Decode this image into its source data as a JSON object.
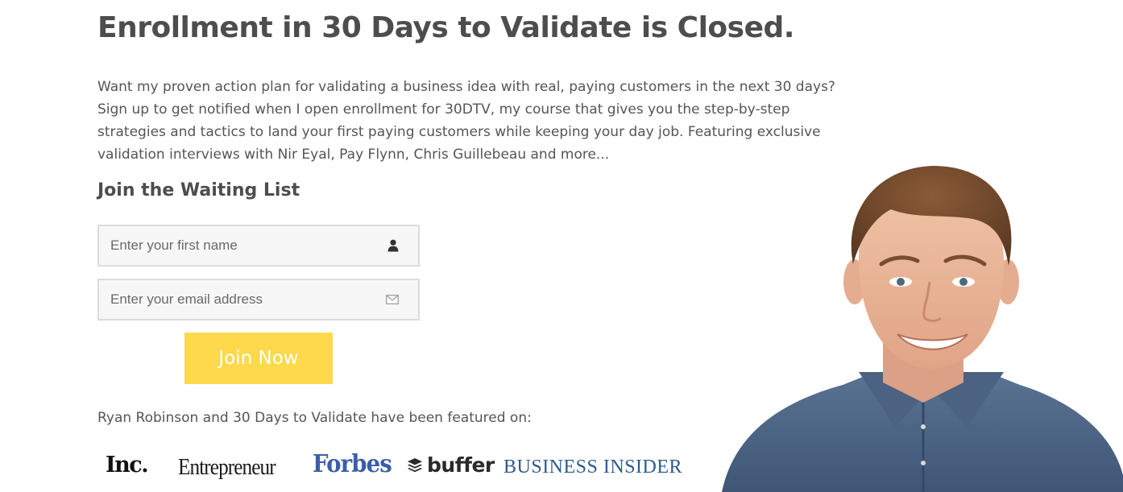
{
  "headline": "Enrollment in 30 Days to Validate is Closed.",
  "intro": "Want my proven action plan for validating a business idea with real, paying customers in the next 30 days? Sign up to get notified when I open enrollment for 30DTV, my course that gives you the step-by-step strategies and tactics to land your first paying customers while keeping your day job. Featuring exclusive validation interviews with Nir Eyal, Pay Flynn, Chris Guillebeau and more...",
  "waitlist": {
    "title": "Join the Waiting List",
    "first_name_placeholder": "Enter your first name",
    "first_name_icon": "person-icon",
    "email_placeholder": "Enter your email address",
    "email_icon": "envelope-icon",
    "submit_label": "Join Now",
    "submit_color": "#fdd94b"
  },
  "featured": {
    "label": "Ryan Robinson and 30 Days to Validate have been featured on:",
    "logos": [
      {
        "name": "Inc.",
        "color": "#111111"
      },
      {
        "name": "Entrepreneur",
        "color": "#1a1a1a"
      },
      {
        "name": "Forbes",
        "color": "#3b5ea8"
      },
      {
        "name": "buffer",
        "color": "#2a2a2a"
      },
      {
        "name": "Business Insider",
        "color": "#2d5a8e"
      }
    ]
  },
  "portrait": {
    "subject": "smiling man in blue denim shirt"
  }
}
